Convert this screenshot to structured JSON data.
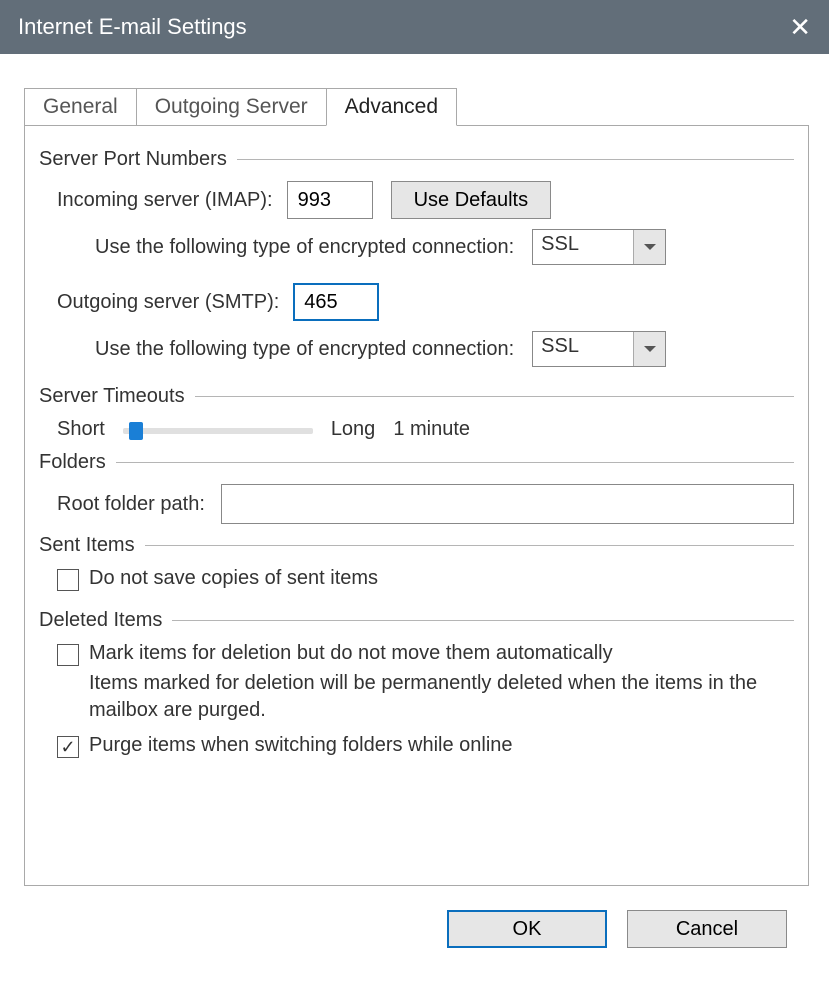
{
  "window": {
    "title": "Internet E-mail Settings"
  },
  "tabs": {
    "general": "General",
    "outgoing": "Outgoing Server",
    "advanced": "Advanced"
  },
  "server_ports": {
    "group_label": "Server Port Numbers",
    "incoming_label": "Incoming server (IMAP):",
    "incoming_value": "993",
    "use_defaults_btn": "Use Defaults",
    "incoming_enc_label": "Use the following type of encrypted connection:",
    "incoming_enc_value": "SSL",
    "outgoing_label": "Outgoing server (SMTP):",
    "outgoing_value": "465",
    "outgoing_enc_label": "Use the following type of encrypted connection:",
    "outgoing_enc_value": "SSL"
  },
  "timeouts": {
    "group_label": "Server Timeouts",
    "short_label": "Short",
    "long_label": "Long",
    "value_label": "1 minute"
  },
  "folders": {
    "group_label": "Folders",
    "root_label": "Root folder path:",
    "root_value": ""
  },
  "sent": {
    "group_label": "Sent Items",
    "dont_save_label": "Do not save copies of sent items",
    "dont_save_checked": false
  },
  "deleted": {
    "group_label": "Deleted Items",
    "mark_label": "Mark items for deletion but do not move them automatically",
    "mark_checked": false,
    "hint": "Items marked for deletion will be permanently deleted when the items in the mailbox are purged.",
    "purge_label": "Purge items when switching folders while online",
    "purge_checked": true
  },
  "buttons": {
    "ok": "OK",
    "cancel": "Cancel"
  }
}
